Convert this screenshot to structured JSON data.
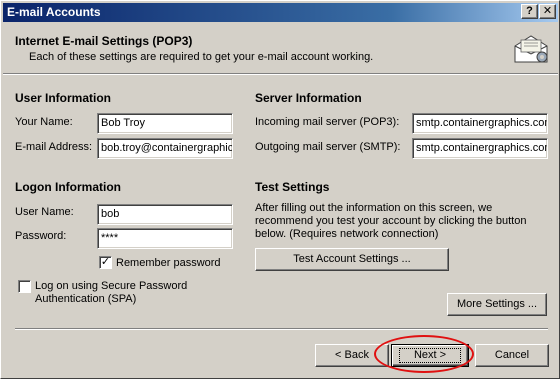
{
  "window": {
    "title": "E-mail Accounts",
    "help_glyph": "?",
    "close_glyph": "✕"
  },
  "header": {
    "title": "Internet E-mail Settings (POP3)",
    "subtitle": "Each of these settings are required to get your e-mail account working.",
    "icon": "mail-settings-icon"
  },
  "user_info": {
    "title": "User Information",
    "name_label": "Your Name:",
    "name_value": "Bob Troy",
    "email_label": "E-mail Address:",
    "email_value": "bob.troy@containergraphics.com"
  },
  "server_info": {
    "title": "Server Information",
    "incoming_label": "Incoming mail server (POP3):",
    "incoming_value": "smtp.containergraphics.com",
    "outgoing_label": "Outgoing mail server (SMTP):",
    "outgoing_value": "smtp.containergraphics.com"
  },
  "logon_info": {
    "title": "Logon Information",
    "username_label": "User Name:",
    "username_value": "bob",
    "password_label": "Password:",
    "password_value": "****",
    "remember_label": "Remember password",
    "remember_checked": true,
    "spa_label_line1": "Log on using Secure Password",
    "spa_label_line2": "Authentication (SPA)",
    "spa_checked": false
  },
  "test_settings": {
    "title": "Test Settings",
    "description_line1": "After filling out the information on this screen, we",
    "description_line2": "recommend you test your account by clicking the button",
    "description_line3": "below. (Requires network connection)",
    "test_button": "Test Account Settings ..."
  },
  "buttons": {
    "more_settings": "More Settings ...",
    "back": "< Back",
    "next": "Next >",
    "cancel": "Cancel"
  },
  "colors": {
    "highlight_ellipse": "#e01010",
    "titlebar": "#0a246a"
  }
}
